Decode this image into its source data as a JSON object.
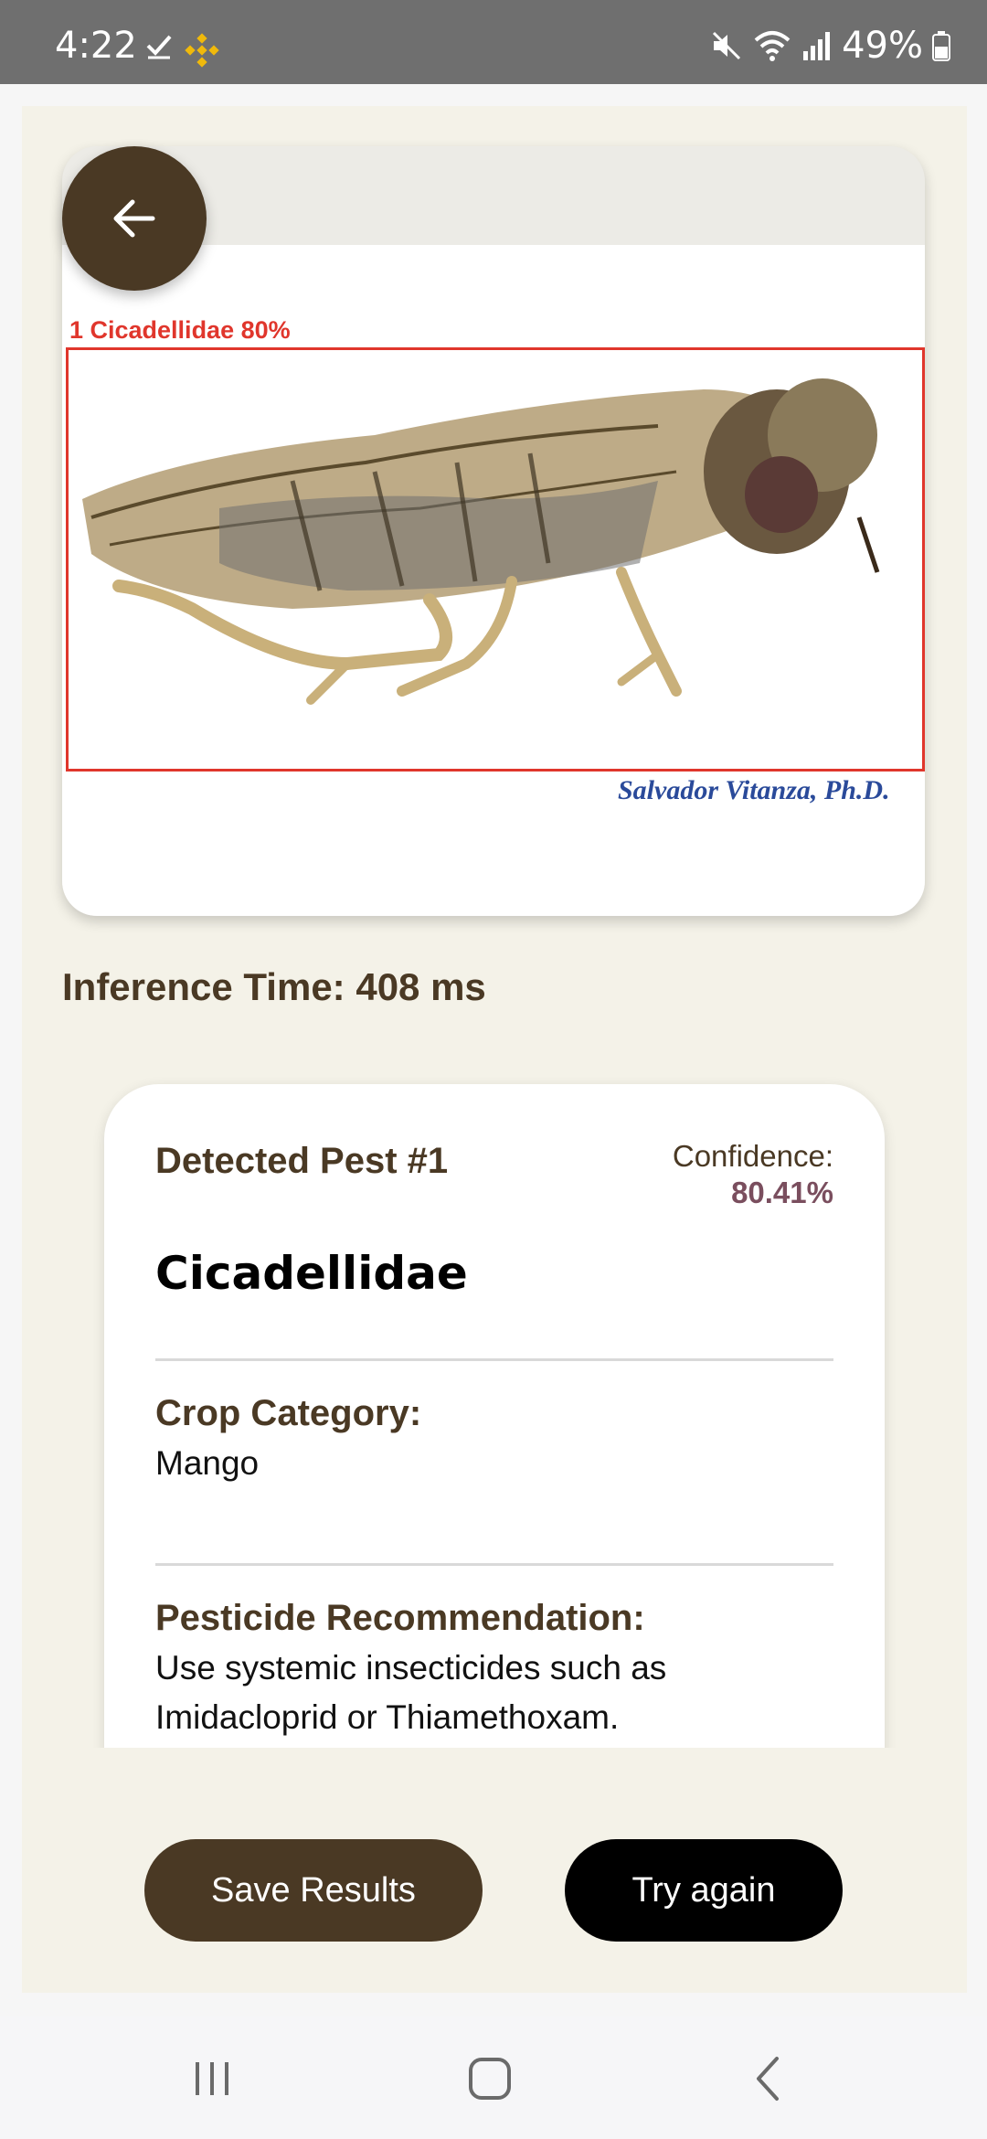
{
  "status_bar": {
    "time": "4:22",
    "battery": "49%",
    "icons": [
      "check-icon",
      "binance-icon",
      "mute-icon",
      "wifi-icon",
      "signal-icon",
      "battery-icon"
    ]
  },
  "image": {
    "detection_label": "1 Cicadellidae 80%",
    "credit": "Salvador Vitanza, Ph.D."
  },
  "inference": {
    "text": "Inference Time: 408 ms"
  },
  "result": {
    "title": "Detected Pest #1",
    "confidence_label": "Confidence:",
    "confidence_value": "80.41%",
    "pest_name": "Cicadellidae",
    "crop_label": "Crop Category:",
    "crop_value": "Mango",
    "pesticide_label": "Pesticide Recommendation:",
    "pesticide_value": "Use systemic insecticides such as Imidacloprid or Thiamethoxam."
  },
  "actions": {
    "save": "Save Results",
    "retry": "Try again"
  },
  "colors": {
    "brand_brown": "#4a3924",
    "panel_bg": "#f4f2e8",
    "detection_red": "#e0362c",
    "confidence_accent": "#7a4e5e"
  }
}
